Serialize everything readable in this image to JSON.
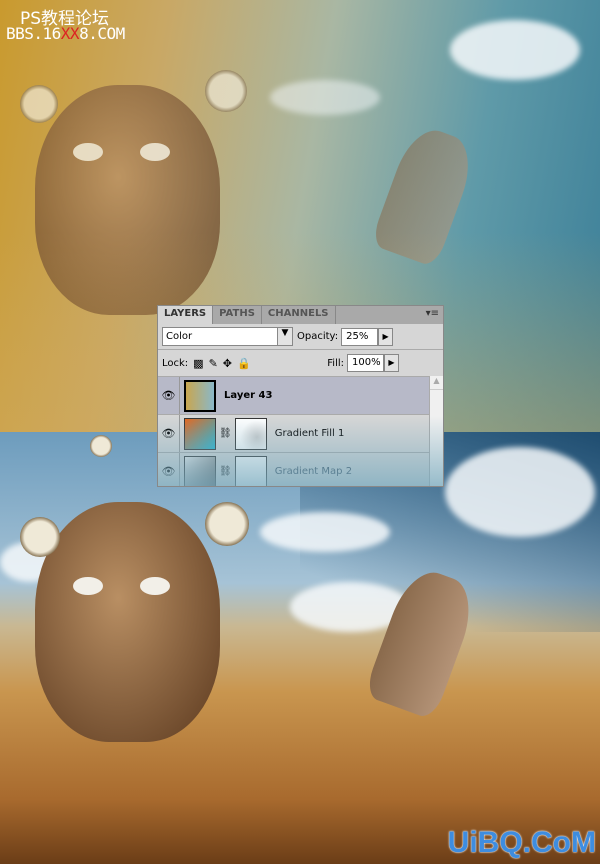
{
  "watermarks": {
    "top_line1": "PS教程论坛",
    "top_line2_a": "BBS.16",
    "top_line2_b": "XX",
    "top_line2_c": "8.COM",
    "bottom_right": "UiBQ.CoM"
  },
  "layers_panel": {
    "tabs": [
      {
        "label": "LAYERS",
        "active": true
      },
      {
        "label": "PATHS",
        "active": false
      },
      {
        "label": "CHANNELS",
        "active": false
      }
    ],
    "blend_mode": "Color",
    "opacity_label": "Opacity:",
    "opacity_value": "25%",
    "lock_label": "Lock:",
    "fill_label": "Fill:",
    "fill_value": "100%",
    "layers": [
      {
        "name": "Layer 43",
        "selected": true,
        "visible": true
      },
      {
        "name": "Gradient Fill 1",
        "selected": false,
        "visible": true
      },
      {
        "name": "Gradient Map 2",
        "selected": false,
        "visible": true
      }
    ]
  },
  "colors": {
    "accent_selected_row": "#b7b9c8",
    "watermark_red": "#dd2222",
    "watermark_blue": "#3e8de0"
  }
}
